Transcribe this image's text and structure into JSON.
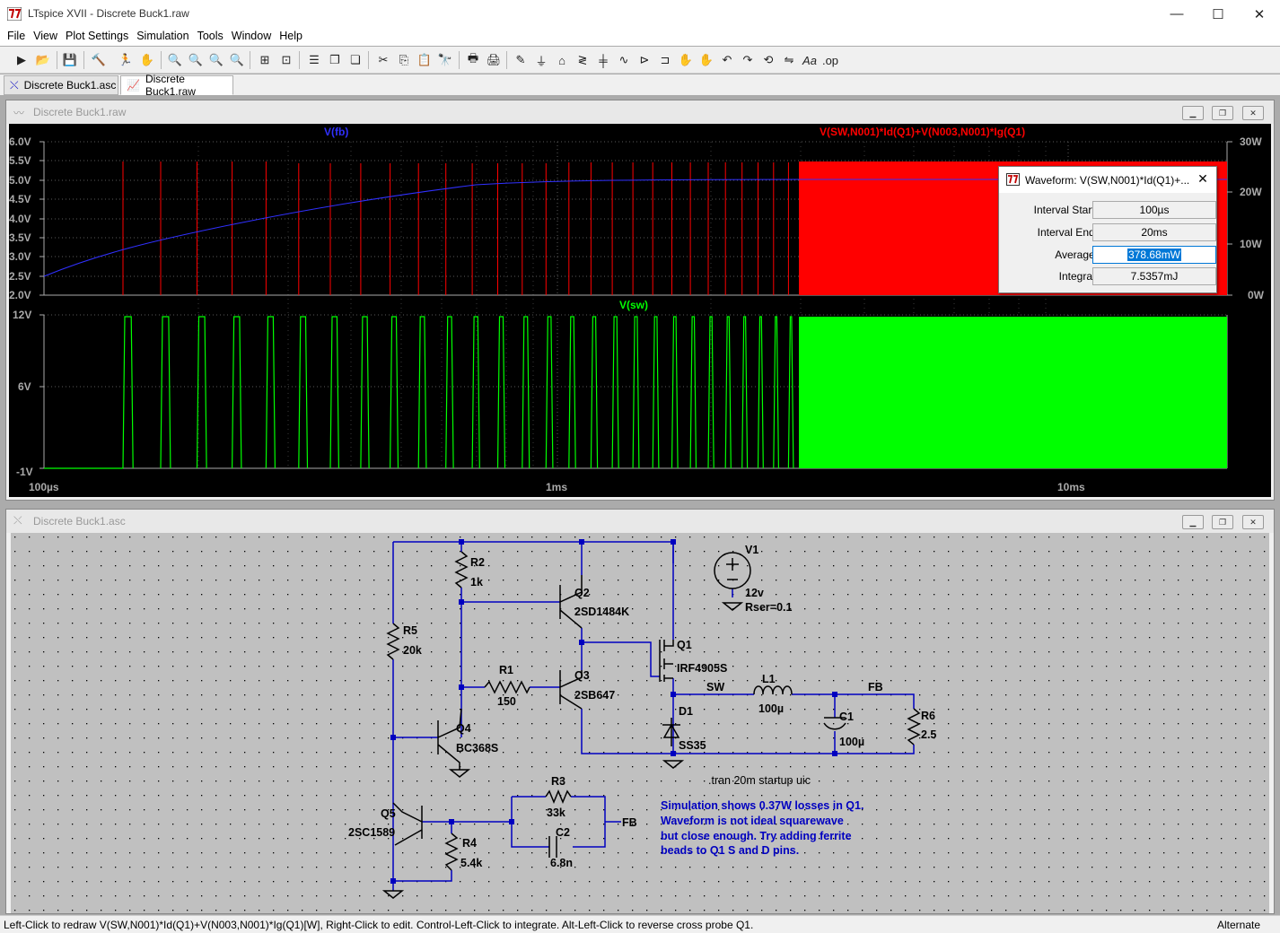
{
  "window": {
    "title": "LTspice XVII - Discrete Buck1.raw"
  },
  "menu": [
    "File",
    "View",
    "Plot Settings",
    "Simulation",
    "Tools",
    "Window",
    "Help"
  ],
  "tabs": [
    {
      "label": "Discrete Buck1.asc"
    },
    {
      "label": "Discrete Buck1.raw"
    }
  ],
  "plot_window": {
    "title": "Discrete Buck1.raw"
  },
  "schematic_window": {
    "title": "Discrete Buck1.asc"
  },
  "waveform": {
    "top_left_trace": "V(fb)",
    "top_right_trace": "V(SW,N001)*Id(Q1)+V(N003,N001)*Ig(Q1)",
    "top_left_ticks": [
      "6.0V",
      "5.5V",
      "5.0V",
      "4.5V",
      "4.0V",
      "3.5V",
      "3.0V",
      "2.5V",
      "2.0V"
    ],
    "top_right_ticks": [
      "30W",
      "20W",
      "10W",
      "0W"
    ],
    "bottom_trace": "V(sw)",
    "bottom_ticks": [
      "12V",
      "6V",
      "-1V"
    ],
    "x_ticks": [
      "100µs",
      "1ms",
      "10ms"
    ]
  },
  "dialog": {
    "title": "Waveform: V(SW,N001)*Id(Q1)+...",
    "rows": [
      {
        "label": "Interval Start:",
        "value": "100µs"
      },
      {
        "label": "Interval End:",
        "value": "20ms"
      },
      {
        "label": "Average:",
        "value": "378.68mW"
      },
      {
        "label": "Integral:",
        "value": "7.5357mJ"
      }
    ]
  },
  "schematic": {
    "labels": {
      "v1": "V1",
      "v1val": "12v",
      "v1rser": "Rser=0.1",
      "r2": "R2",
      "r2val": "1k",
      "q2": "Q2",
      "q2val": "2SD1484K",
      "r5": "R5",
      "r5val": "20k",
      "q1": "Q1",
      "q1val": "IRF4905S",
      "r1": "R1",
      "r1val": "150",
      "q3": "Q3",
      "q3val": "2SB647",
      "sw": "SW",
      "l1": "L1",
      "l1val": "100µ",
      "fb": "FB",
      "c1": "C1",
      "c1val": "100µ",
      "r6": "R6",
      "r6val": "2.5",
      "d1": "D1",
      "d1val": "SS35",
      "q4": "Q4",
      "q4val": "BC368S",
      "tran": ".tran 20m startup uic",
      "q5": "Q5",
      "q5val": "2SC1589",
      "r3": "R3",
      "r3val": "33k",
      "c2": "C2",
      "c2val": "6.8n",
      "r4": "R4",
      "r4val": "5.4k",
      "fb2": "FB"
    },
    "comment": [
      "Simulation shows 0.37W losses in Q1.",
      "Waveform is not ideal squarewave",
      "but close enough. Try adding ferrite",
      "beads to Q1 S and D pins."
    ]
  },
  "status": {
    "message": "Left-Click to redraw V(SW,N001)*Id(Q1)+V(N003,N001)*Ig(Q1)[W],  Right-Click to edit. Control-Left-Click to integrate. Alt-Left-Click to reverse cross probe Q1.",
    "mode": "Alternate"
  },
  "colors": {
    "vfb": "#3030ff",
    "power": "#ff0000",
    "vsw": "#00ff00",
    "wire": "#0000c0",
    "comment": "#0000c0",
    "schematic_bg": "#c0c0c0"
  }
}
